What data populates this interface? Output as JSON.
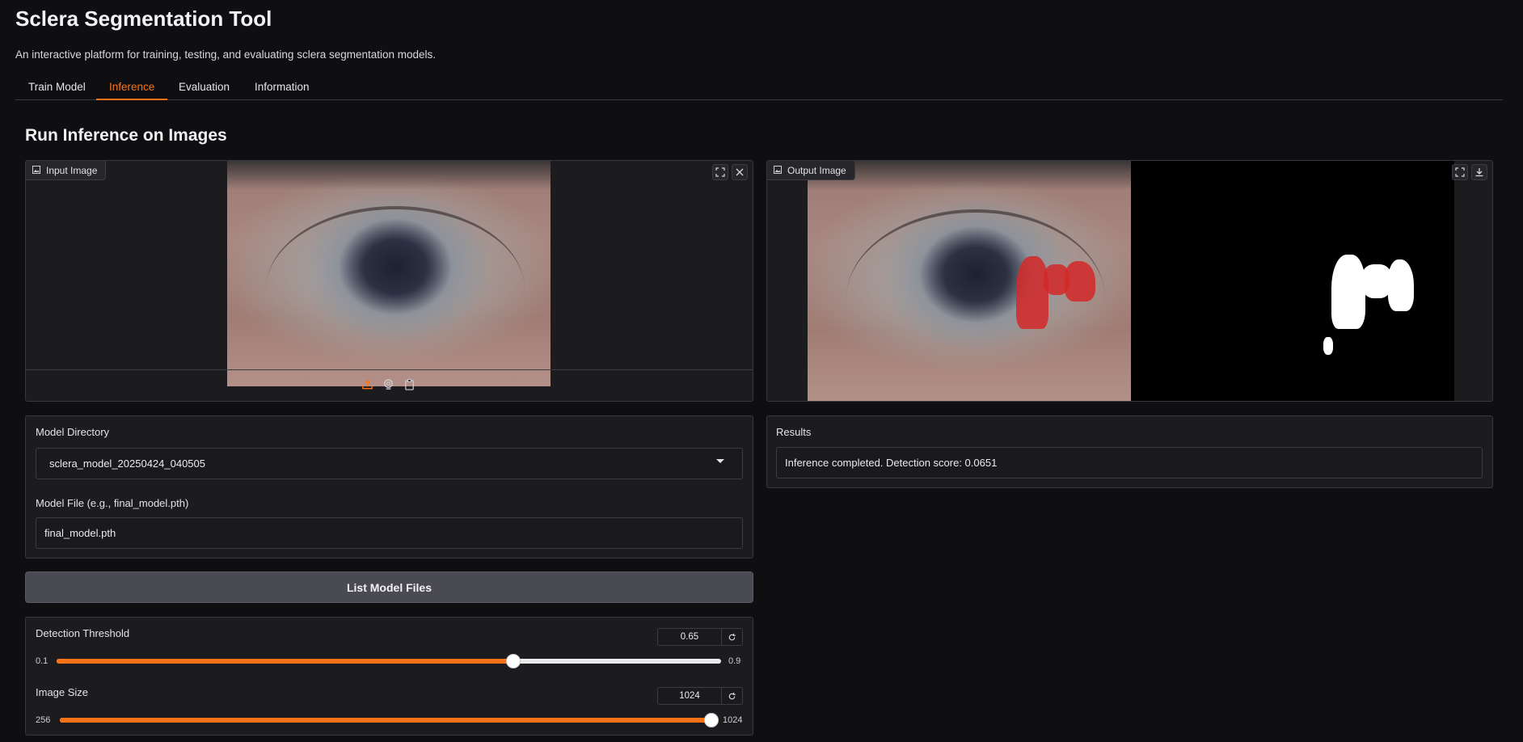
{
  "app": {
    "title": "Sclera Segmentation Tool",
    "subtitle": "An interactive platform for training, testing, and evaluating sclera segmentation models."
  },
  "tabs": [
    {
      "label": "Train Model",
      "active": false
    },
    {
      "label": "Inference",
      "active": true
    },
    {
      "label": "Evaluation",
      "active": false
    },
    {
      "label": "Information",
      "active": false
    }
  ],
  "section_title": "Run Inference on Images",
  "input_image": {
    "label": "Input Image",
    "icons": [
      "image-icon",
      "fullscreen-icon",
      "close-icon",
      "upload-icon",
      "webcam-icon",
      "clipboard-icon"
    ]
  },
  "output_image": {
    "label": "Output Image",
    "icons": [
      "image-icon",
      "fullscreen-icon",
      "download-icon"
    ]
  },
  "model_directory": {
    "label": "Model Directory",
    "value": "sclera_model_20250424_040505"
  },
  "model_file": {
    "label": "Model File (e.g., final_model.pth)",
    "value": "final_model.pth"
  },
  "list_button": "List Model Files",
  "detection_threshold": {
    "label": "Detection Threshold",
    "value": "0.65",
    "min": "0.1",
    "max": "0.9",
    "fraction": 0.6875
  },
  "image_size": {
    "label": "Image Size",
    "value": "1024",
    "min": "256",
    "max": "1024",
    "fraction": 1.0
  },
  "results": {
    "label": "Results",
    "text": "Inference completed. Detection score: 0.0651"
  },
  "colors": {
    "accent": "#f97316",
    "background": "#0f0f11",
    "panel": "#1c1c1f"
  }
}
